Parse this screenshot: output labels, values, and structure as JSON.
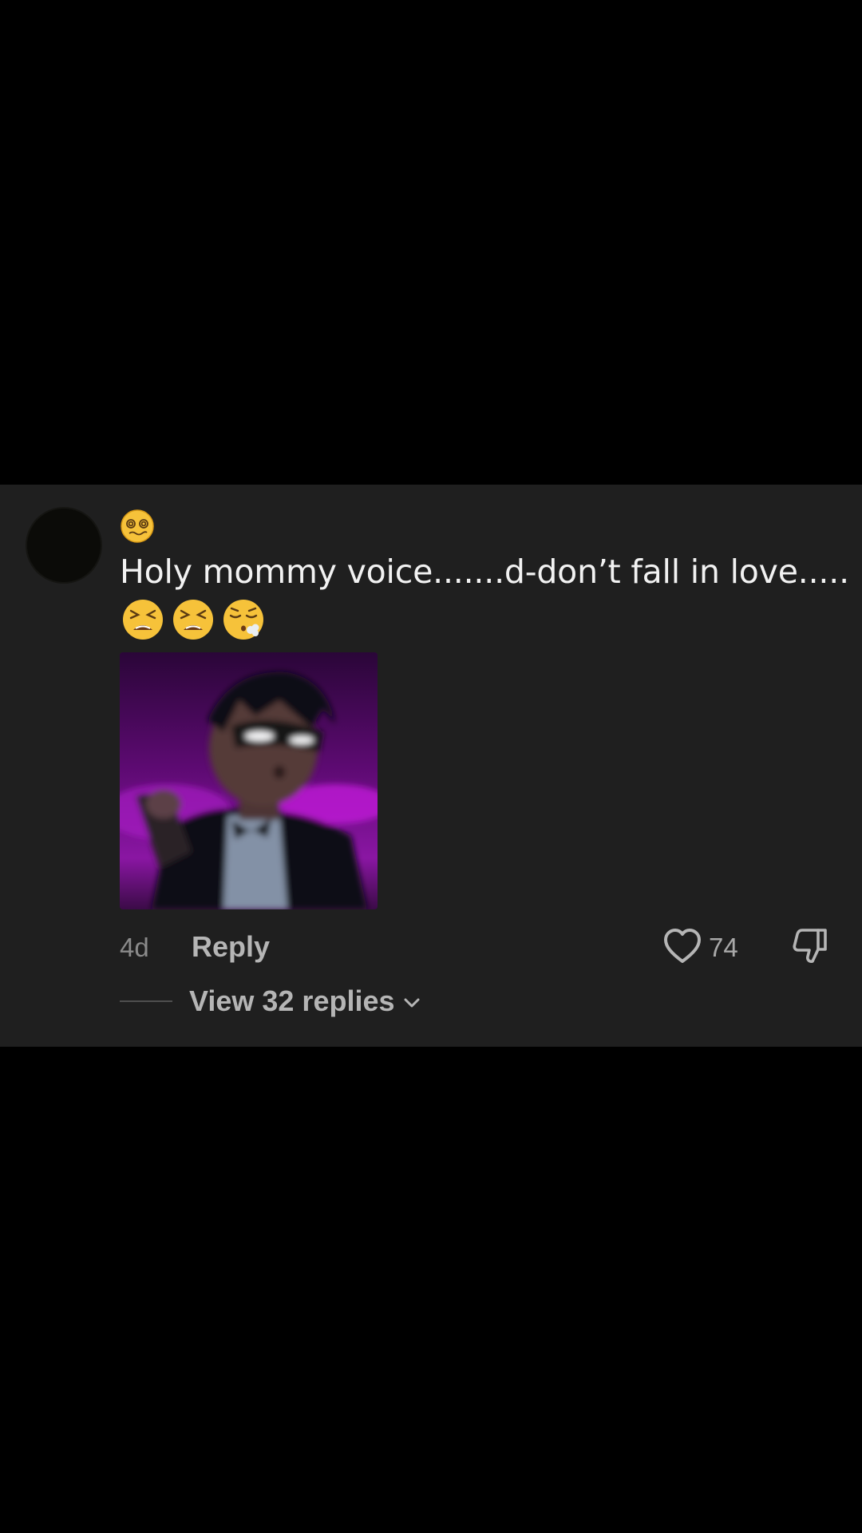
{
  "comment": {
    "author_emoji": "face-with-spiral-eyes",
    "text": "Holy mommy voice.......d-don’t fall in love.....",
    "emojis": [
      "tired-face",
      "tired-face",
      "face-exhaling"
    ],
    "attached_image": "blurred-cartoon-character-in-tuxedo",
    "time": "4d",
    "reply_label": "Reply",
    "like_count": "74",
    "view_replies_label": "View 32 replies"
  },
  "colors": {
    "background": "#000000",
    "card": "#1f1f1f",
    "text_primary": "#f2f2f2",
    "text_secondary": "#8a8a8a",
    "action_text": "#b5b5b5"
  },
  "icons": {
    "like": "heart-outline-icon",
    "dislike": "thumbs-down-icon",
    "expand": "chevron-down-icon"
  }
}
